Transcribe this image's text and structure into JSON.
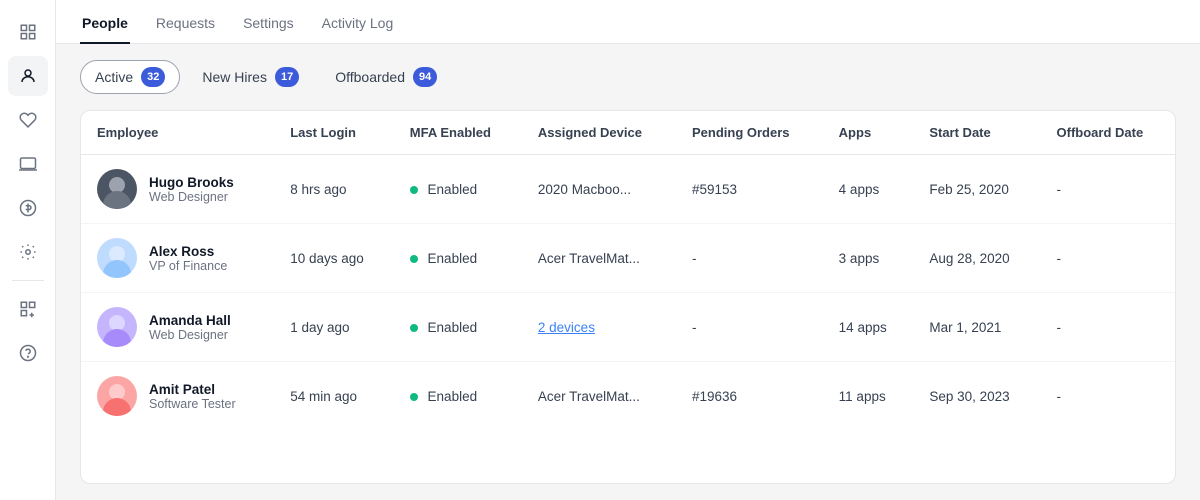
{
  "sidebar": {
    "icons": [
      {
        "name": "grid-icon",
        "symbol": "⊞",
        "active": false
      },
      {
        "name": "people-icon",
        "symbol": "👤",
        "active": true
      },
      {
        "name": "heart-icon",
        "symbol": "♡",
        "active": false
      },
      {
        "name": "laptop-icon",
        "symbol": "💻",
        "active": false
      },
      {
        "name": "dollar-icon",
        "symbol": "＄",
        "active": false
      },
      {
        "name": "gear-icon",
        "symbol": "⚙",
        "active": false
      },
      {
        "name": "apps-icon",
        "symbol": "⊞",
        "active": false
      },
      {
        "name": "question-icon",
        "symbol": "?",
        "active": false
      }
    ]
  },
  "nav": {
    "tabs": [
      {
        "label": "People",
        "active": true
      },
      {
        "label": "Requests",
        "active": false
      },
      {
        "label": "Settings",
        "active": false
      },
      {
        "label": "Activity Log",
        "active": false
      }
    ]
  },
  "filters": {
    "buttons": [
      {
        "label": "Active",
        "badge": "32",
        "active": true
      },
      {
        "label": "New Hires",
        "badge": "17",
        "active": false
      },
      {
        "label": "Offboarded",
        "badge": "94",
        "active": false
      }
    ]
  },
  "table": {
    "columns": [
      "Employee",
      "Last Login",
      "MFA Enabled",
      "Assigned Device",
      "Pending Orders",
      "Apps",
      "Start Date",
      "Offboard Date"
    ],
    "rows": [
      {
        "name": "Hugo Brooks",
        "role": "Web Designer",
        "lastLogin": "8 hrs ago",
        "mfa": "Enabled",
        "device": "2020 Macboo...",
        "deviceLink": false,
        "pendingOrders": "#59153",
        "apps": "4 apps",
        "startDate": "Feb 25, 2020",
        "offboardDate": "-",
        "avatarClass": "avatar-hugo",
        "avatarHeadColor": "#9ca3af",
        "avatarBodyColor": "#6b7280"
      },
      {
        "name": "Alex Ross",
        "role": "VP of Finance",
        "lastLogin": "10 days ago",
        "mfa": "Enabled",
        "device": "Acer TravelMat...",
        "deviceLink": false,
        "pendingOrders": "-",
        "apps": "3 apps",
        "startDate": "Aug 28, 2020",
        "offboardDate": "-",
        "avatarClass": "avatar-alex",
        "avatarHeadColor": "#bfdbfe",
        "avatarBodyColor": "#93c5fd"
      },
      {
        "name": "Amanda Hall",
        "role": "Web Designer",
        "lastLogin": "1 day ago",
        "mfa": "Enabled",
        "device": "2 devices",
        "deviceLink": true,
        "pendingOrders": "-",
        "apps": "14 apps",
        "startDate": "Mar 1, 2021",
        "offboardDate": "-",
        "avatarClass": "avatar-amanda",
        "avatarHeadColor": "#c4b5fd",
        "avatarBodyColor": "#a78bfa"
      },
      {
        "name": "Amit Patel",
        "role": "Software Tester",
        "lastLogin": "54 min ago",
        "mfa": "Enabled",
        "device": "Acer TravelMat...",
        "deviceLink": false,
        "pendingOrders": "#19636",
        "apps": "11 apps",
        "startDate": "Sep 30, 2023",
        "offboardDate": "-",
        "avatarClass": "avatar-amit",
        "avatarHeadColor": "#fca5a5",
        "avatarBodyColor": "#f87171"
      }
    ]
  }
}
